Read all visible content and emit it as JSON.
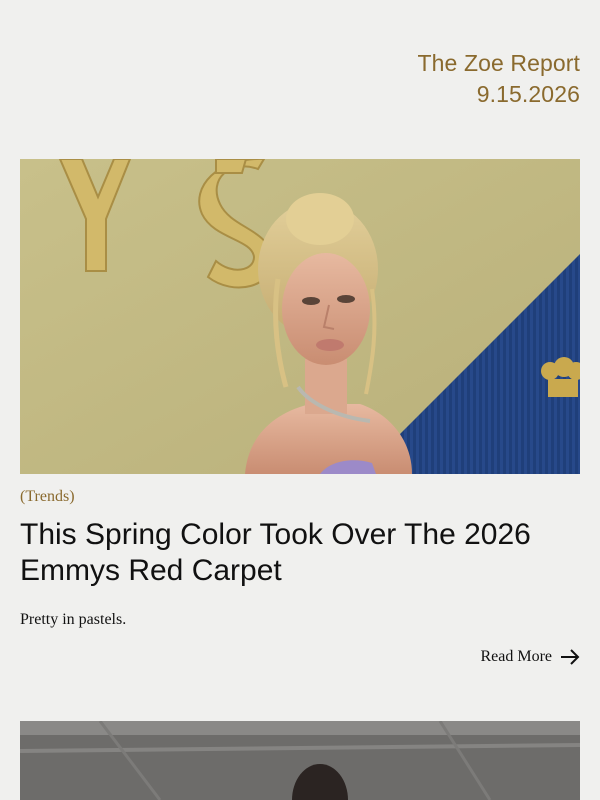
{
  "header": {
    "brand": "The Zoe Report",
    "date": "9.15.2026"
  },
  "article": {
    "category": "(Trends)",
    "headline": "This Spring Color Took Over The 2026 Emmys Red Carpet",
    "dek": "Pretty in pastels.",
    "read_more_label": "Read More",
    "read_more_icon": "arrow-right-icon",
    "image_description_icon": "photo"
  },
  "colors": {
    "accent": "#8a6a2e",
    "background": "#f0f0ee",
    "text": "#111111"
  }
}
